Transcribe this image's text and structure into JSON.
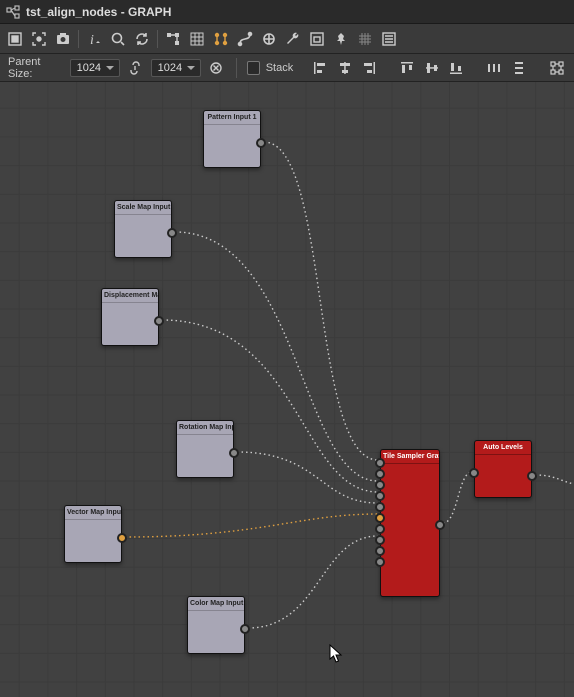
{
  "window": {
    "title": "tst_align_nodes - GRAPH"
  },
  "parentSize": {
    "label": "Parent Size:",
    "width": "1024",
    "height": "1024"
  },
  "stack": {
    "label": "Stack"
  },
  "nodes": {
    "pattern": {
      "label": "Pattern Input 1"
    },
    "scale": {
      "label": "Scale Map Input"
    },
    "displacement": {
      "label": "Displacement Map Input"
    },
    "rotation": {
      "label": "Rotation Map Input"
    },
    "vector": {
      "label": "Vector Map Input"
    },
    "color": {
      "label": "Color Map Input"
    },
    "tileSampler": {
      "label": "Tile Sampler Grayscale"
    },
    "autoLevels": {
      "label": "Auto Levels"
    }
  }
}
